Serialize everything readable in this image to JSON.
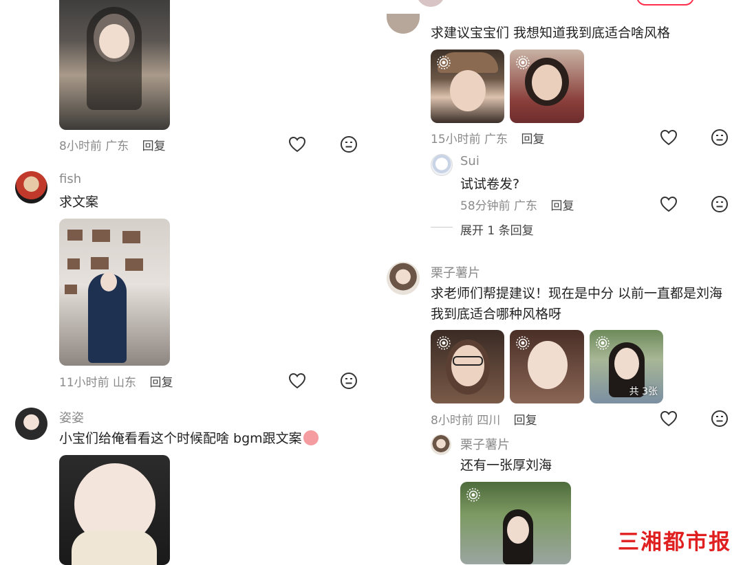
{
  "left": {
    "c1": {
      "meta_time": "8小时前",
      "meta_loc": "广东",
      "reply": "回复"
    },
    "c2": {
      "user": "fish",
      "text": "求文案",
      "meta_time": "11小时前",
      "meta_loc": "山东",
      "reply": "回复"
    },
    "c3": {
      "user": "姿姿",
      "text": "小宝们给俺看看这个时候配啥 bgm跟文案"
    }
  },
  "right": {
    "c1": {
      "text": "求建议宝宝们 我想知道我到底适合啥风格",
      "meta_time": "15小时前",
      "meta_loc": "广东",
      "reply": "回复"
    },
    "sub1": {
      "user": "Sui",
      "text": "试试卷发?",
      "meta_time": "58分钟前",
      "meta_loc": "广东",
      "reply": "回复"
    },
    "expand": "展开 1 条回复",
    "c2": {
      "user": "栗子薯片",
      "text_line1": "求老师们帮提建议！现在是中分 以前一直都是刘海",
      "text_line2": "我到底适合哪种风格呀",
      "count_badge": "共 3张",
      "meta_time": "8小时前",
      "meta_loc": "四川",
      "reply": "回复"
    },
    "sub2": {
      "user": "栗子薯片",
      "text": "还有一张厚刘海"
    }
  },
  "watermark": "三湘都市报",
  "colors": {
    "accent": "#ff2e4d",
    "meta_gray": "#8a8a8a",
    "watermark_red": "#e02020"
  }
}
